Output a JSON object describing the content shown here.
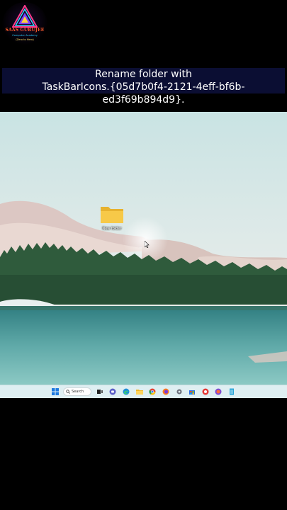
{
  "branding": {
    "logo_title": "SAAS GURUJEE",
    "logo_subtitle": "Computer Academy",
    "logo_tagline": "(Zero to Hero)"
  },
  "caption": {
    "line1": "Rename folder with",
    "line2": "TaskBarIcons.{05d7b0f4-2121-4eff-bf6b-ed3f69b894d9}."
  },
  "desktop": {
    "folder_label": "New folder"
  },
  "taskbar": {
    "search_label": "Search",
    "icons": [
      "windows-start-icon",
      "search-icon",
      "task-view-icon",
      "chat-icon",
      "edge-icon",
      "file-explorer-icon",
      "chrome-icon",
      "firefox-icon",
      "settings-icon",
      "store-icon",
      "app-icon",
      "app-icon",
      "app-icon",
      "notepad-icon"
    ]
  },
  "colors": {
    "caption_bg": "#0b0e33",
    "taskbar_bg": "#dfeff2",
    "folder_yellow": "#f7c948"
  }
}
